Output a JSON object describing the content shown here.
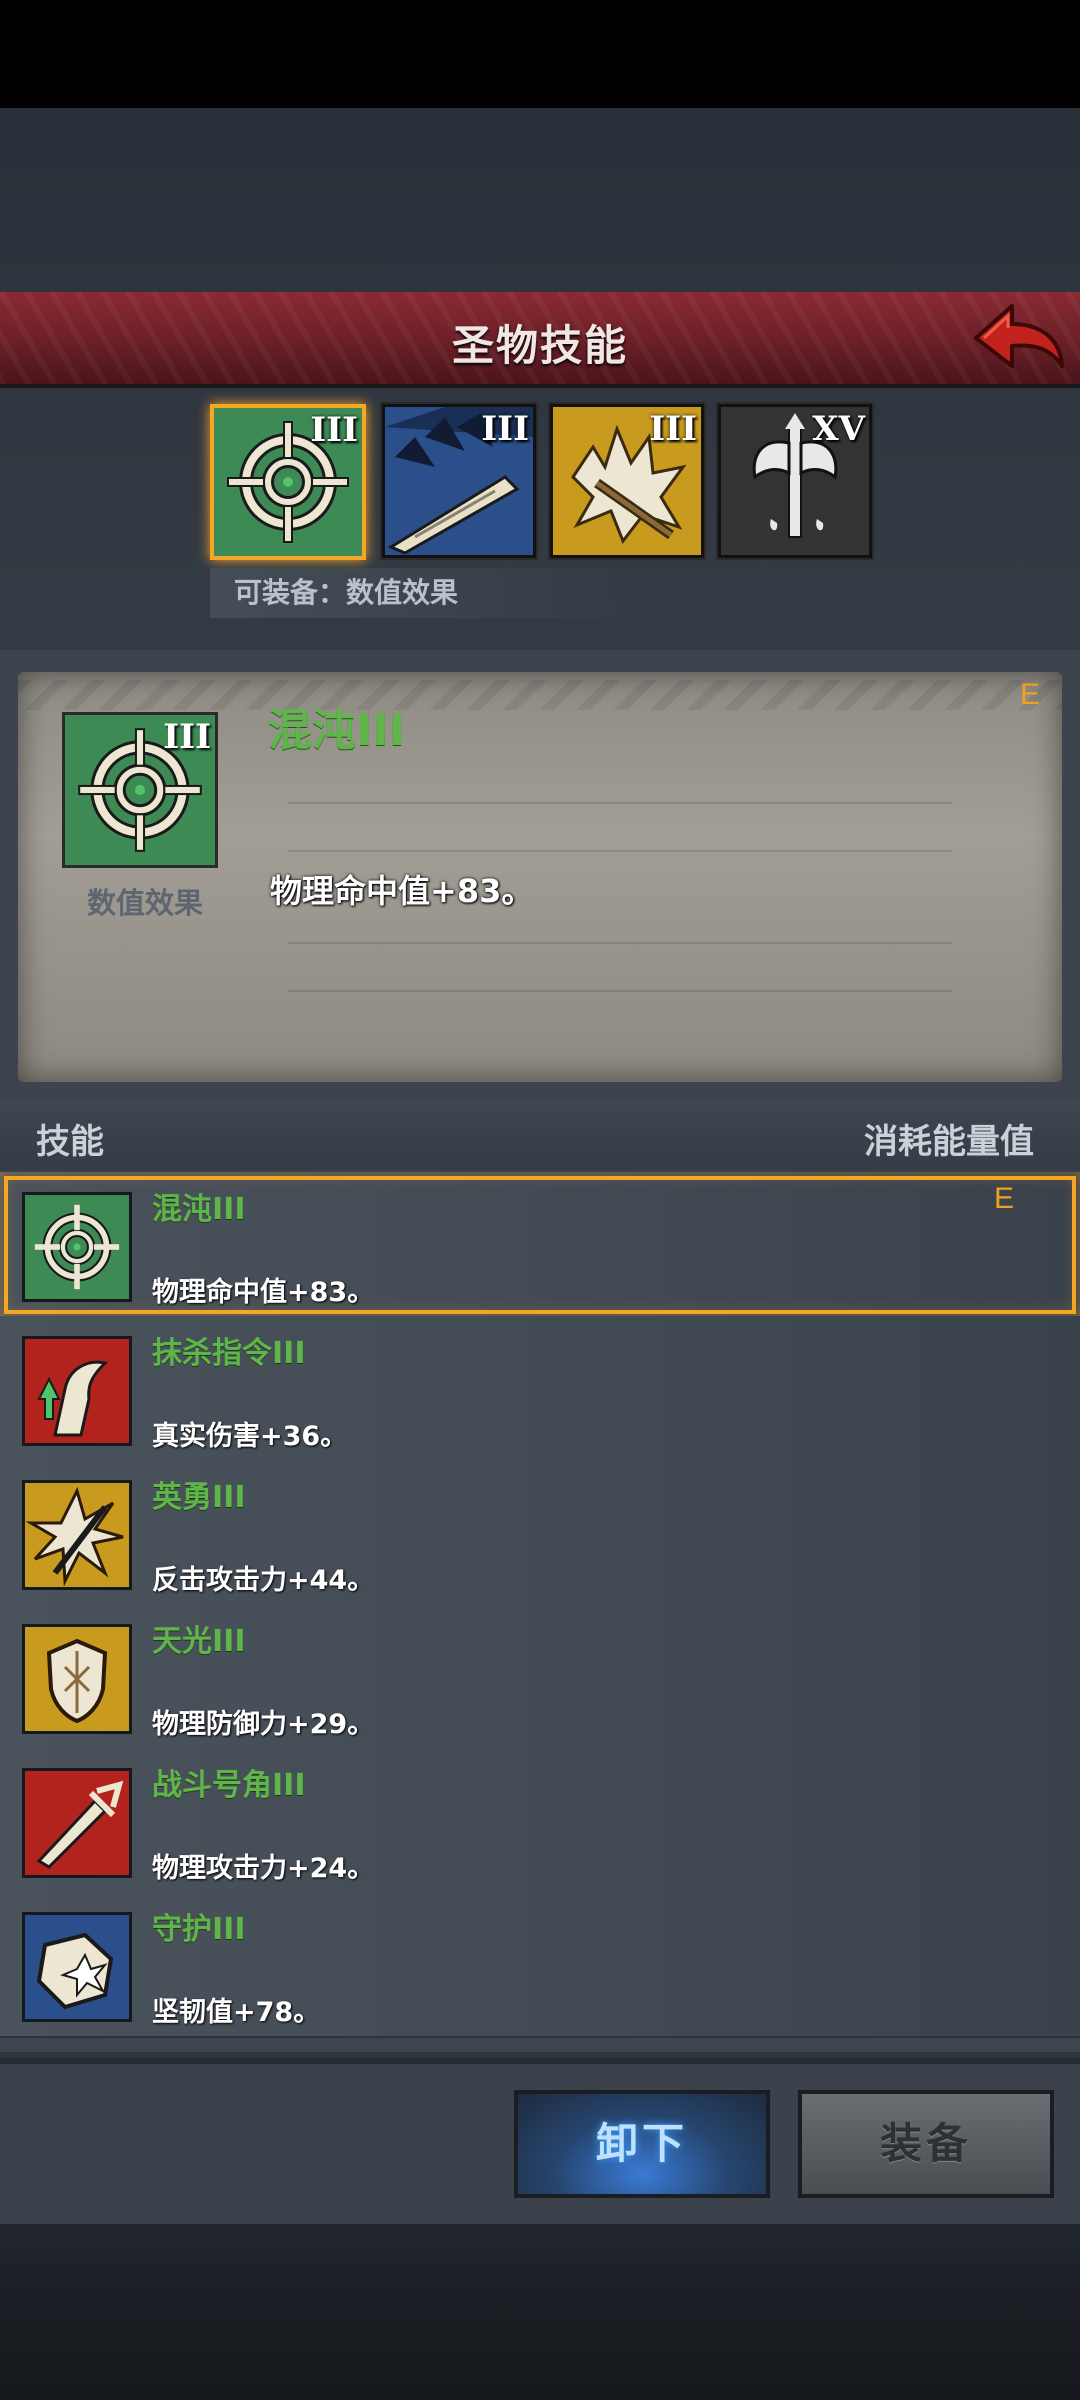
{
  "header": {
    "title": "圣物技能"
  },
  "relics": [
    {
      "level": "III",
      "icon": "crosshair-icon",
      "color": "#3e8a55",
      "selected": true
    },
    {
      "level": "III",
      "icon": "claw-slash-icon",
      "color": "#2a4f8a",
      "selected": false
    },
    {
      "level": "III",
      "icon": "beast-axe-icon",
      "color": "#c89a1e",
      "selected": false
    },
    {
      "level": "XV",
      "icon": "twin-axe-icon",
      "color": "#2a2a2a",
      "selected": false
    }
  ],
  "equip_hint": "可装备：数值效果",
  "detail": {
    "level": "III",
    "type": "数值效果",
    "name": "混沌III",
    "desc": "物理命中值+83。",
    "mark": "E"
  },
  "list_header": {
    "left": "技能",
    "right": "消耗能量值"
  },
  "skills": [
    {
      "name": "混沌III",
      "desc": "物理命中值+83。",
      "icon": "crosshair-icon",
      "color": "#3e8a55",
      "mark": "E",
      "selected": true
    },
    {
      "name": "抹杀指令III",
      "desc": "真实伤害+36。",
      "icon": "arm-arrow-icon",
      "color": "#b3231e",
      "mark": "",
      "selected": false
    },
    {
      "name": "英勇III",
      "desc": "反击攻击力+44。",
      "icon": "burst-sword-icon",
      "color": "#c89a1e",
      "mark": "",
      "selected": false
    },
    {
      "name": "天光III",
      "desc": "物理防御力+29。",
      "icon": "shield-icon",
      "color": "#c89a1e",
      "mark": "",
      "selected": false
    },
    {
      "name": "战斗号角III",
      "desc": "物理攻击力+24。",
      "icon": "sword-icon",
      "color": "#b3231e",
      "mark": "",
      "selected": false
    },
    {
      "name": "守护III",
      "desc": "坚韧值+78。",
      "icon": "shield-burst-icon",
      "color": "#2a4f8a",
      "mark": "",
      "selected": false
    }
  ],
  "buttons": {
    "unload": "卸下",
    "equip": "装备"
  }
}
